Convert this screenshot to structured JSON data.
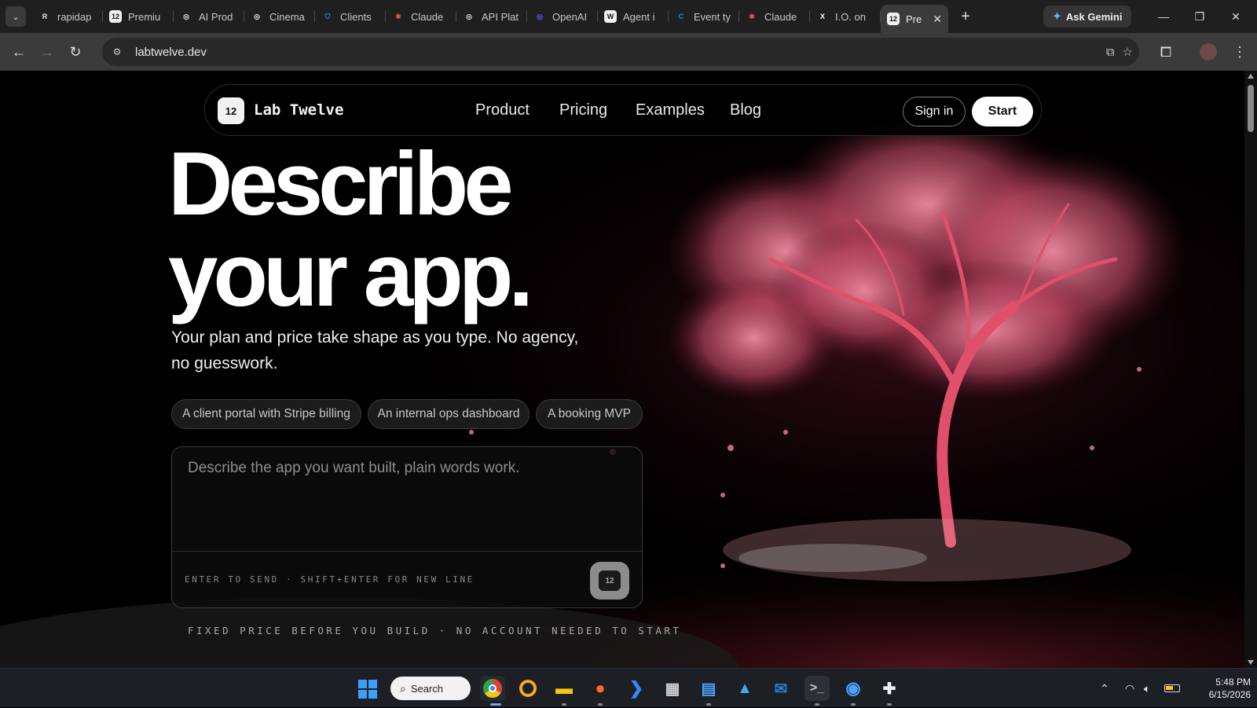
{
  "browser": {
    "tabs": [
      {
        "label": "rapidap",
        "favicon": "R",
        "color": "#e8e8e8"
      },
      {
        "label": "Premiu",
        "favicon": "12",
        "color": "#f0f0f0"
      },
      {
        "label": "AI Prod",
        "favicon": "◎",
        "color": "#e0e0e0"
      },
      {
        "label": "Cinema",
        "favicon": "◎",
        "color": "#e0e0e0"
      },
      {
        "label": "Clients",
        "favicon": "⛉",
        "color": "#4a7dff"
      },
      {
        "label": "Claude",
        "favicon": "✱",
        "color": "#d9534f"
      },
      {
        "label": "API Plat",
        "favicon": "◎",
        "color": "#dcdcdc"
      },
      {
        "label": "OpenAI",
        "favicon": "◎",
        "color": "#5b5bff"
      },
      {
        "label": "Agent i",
        "favicon": "W",
        "color": "#f0f0f0"
      },
      {
        "label": "Event ty",
        "favicon": "C",
        "color": "#3b82f6"
      },
      {
        "label": "Claude",
        "favicon": "✱",
        "color": "#d9534f"
      },
      {
        "label": "I.O. on",
        "favicon": "X",
        "color": "#ffffff"
      },
      {
        "label": "Pre",
        "favicon": "12",
        "color": "#f0f0f0",
        "active": true
      }
    ],
    "ask_gemini": "Ask Gemini",
    "url": "labtwelve.dev"
  },
  "site": {
    "brand_badge": "12",
    "brand_name": "Lab Twelve",
    "nav": [
      "Product",
      "Pricing",
      "Examples",
      "Blog"
    ],
    "signin": "Sign in",
    "start": "Start",
    "headline_line1": "Describe",
    "headline_line2": "your app.",
    "subtitle": "Your plan and price take shape as you type. No agency, no guesswork.",
    "chips": [
      "A client portal with Stripe billing",
      "An internal ops dashboard",
      "A booking MVP"
    ],
    "composer_placeholder": "Describe the app you want built, plain words work.",
    "composer_hint": "ENTER TO SEND · SHIFT+ENTER FOR NEW LINE",
    "send_badge": "12",
    "footnote": "FIXED PRICE BEFORE YOU BUILD · NO ACCOUNT NEEDED TO START"
  },
  "taskbar": {
    "search_label": "Search",
    "time": "5:48 PM",
    "date": "6/15/2026"
  }
}
